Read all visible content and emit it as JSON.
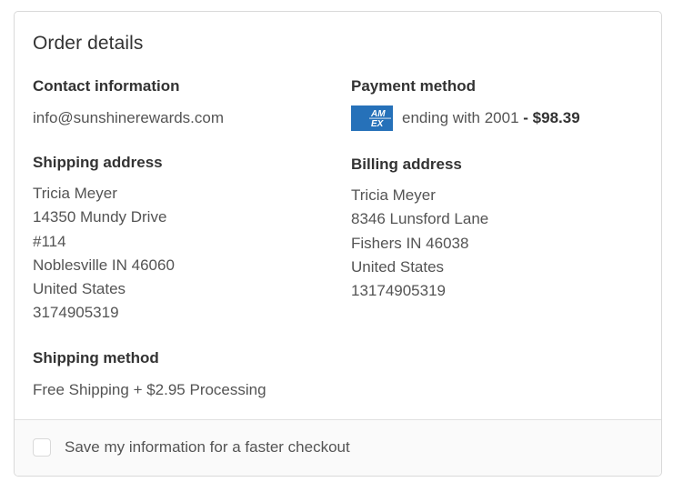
{
  "order": {
    "title": "Order details",
    "contact": {
      "heading": "Contact information",
      "email": "info@sunshinerewards.com"
    },
    "payment": {
      "heading": "Payment method",
      "card_icon": "amex-card-icon",
      "card_text": "ending with 2001",
      "separator": " - ",
      "amount": "$98.39"
    },
    "shipping_address": {
      "heading": "Shipping address",
      "lines": [
        "Tricia Meyer",
        "14350 Mundy Drive",
        "#114",
        "Noblesville IN 46060",
        "United States",
        "3174905319"
      ]
    },
    "billing_address": {
      "heading": "Billing address",
      "lines": [
        "Tricia Meyer",
        "8346 Lunsford Lane",
        "Fishers IN 46038",
        "United States",
        "13174905319"
      ]
    },
    "shipping_method": {
      "heading": "Shipping method",
      "value": "Free Shipping + $2.95 Processing"
    },
    "save_info": {
      "label": "Save my information for a faster checkout",
      "checked": false
    }
  },
  "colors": {
    "card_border": "#d9d9d9",
    "amex_blue": "#2671b9",
    "footer_bg": "#fafafa",
    "text_primary": "#333333",
    "text_secondary": "#545454"
  }
}
